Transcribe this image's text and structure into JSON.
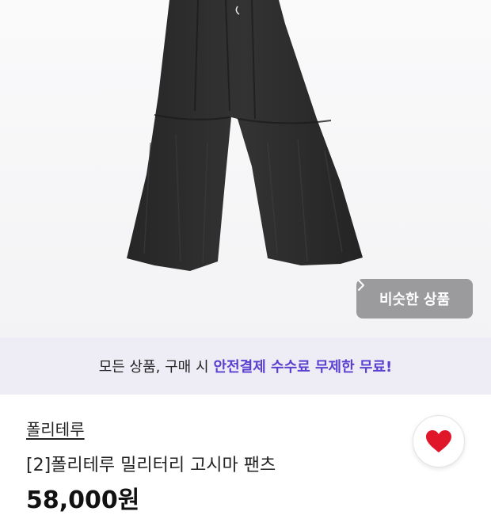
{
  "product_image": {
    "similar_button_label": "비슷한 상품",
    "similar_button_icon": "chevron-right-icon"
  },
  "banner": {
    "text": "모든 상품, 구매 시",
    "highlight": "안전결제 수수료 무제한 무료!",
    "highlight_color": "#5a3fd0"
  },
  "product": {
    "brand": "폴리테루",
    "title": "[2]폴리테루 밀리터리 고시마 팬츠",
    "price": "58,000원"
  },
  "like_button": {
    "icon": "heart-icon",
    "color": "#e0162b"
  }
}
